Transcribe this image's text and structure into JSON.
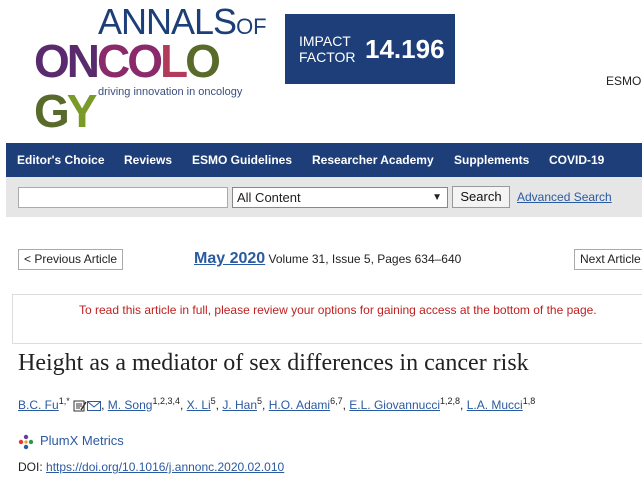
{
  "logo": {
    "annals": "ANNALS",
    "of": "OF",
    "oncology": "ONCOLOGY",
    "tagline": "driving innovation in oncology"
  },
  "impact": {
    "label_line1": "IMPACT",
    "label_line2": "FACTOR",
    "value": "14.196"
  },
  "header_right": {
    "esmo": "ESMO"
  },
  "nav": {
    "items": [
      "Editor's Choice",
      "Reviews",
      "ESMO Guidelines",
      "Researcher Academy",
      "Supplements",
      "COVID-19"
    ]
  },
  "search": {
    "input_value": "",
    "select_value": "All Content",
    "button_label": "Search",
    "advanced_label": "Advanced Search"
  },
  "article_nav": {
    "prev_label": "< Previous Article",
    "next_label": "Next Article",
    "issue_date": "May 2020",
    "issue_detail": "Volume 31, Issue 5, Pages 634–640"
  },
  "notice": "To read this article in full, please review your options for gaining access at the bottom of the page.",
  "article": {
    "title": "Height as a mediator of sex differences in cancer risk",
    "authors": [
      {
        "name": "B.C. Fu",
        "sup": "1,",
        "extra": "*"
      },
      {
        "name": "M. Song",
        "sup": "1,2,3,4"
      },
      {
        "name": "X. Li",
        "sup": "5"
      },
      {
        "name": "J. Han",
        "sup": "5"
      },
      {
        "name": "H.O. Adami",
        "sup": "6,7"
      },
      {
        "name": "E.L. Giovannucci",
        "sup": "1,2,8"
      },
      {
        "name": "L.A. Mucci",
        "sup": "1,8"
      }
    ],
    "plumx_label": "PlumX Metrics",
    "doi_label": "DOI:",
    "doi_link": "https://doi.org/10.1016/j.annonc.2020.02.010"
  },
  "colors": {
    "brand_navy": "#1d3e78",
    "link_blue": "#2a5aa0",
    "notice_red": "#c02020",
    "logo_gradient": [
      "#5a2a6e",
      "#8a2a6a",
      "#b23a5a",
      "#5a6a2a",
      "#7a9a2a"
    ]
  },
  "icons": [
    "edit-icon",
    "email-icon",
    "plumx-icon",
    "dropdown-arrow-icon"
  ]
}
